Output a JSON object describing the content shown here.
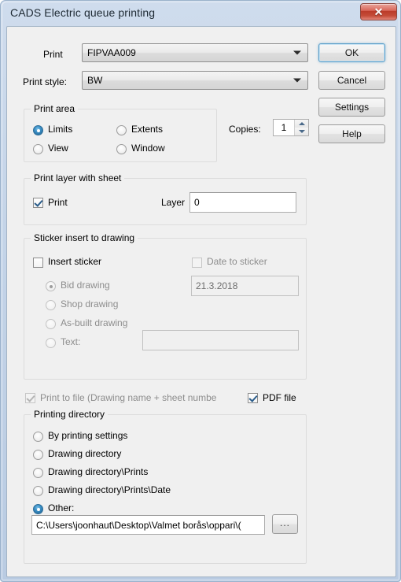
{
  "window": {
    "title": "CADS Electric queue printing",
    "close_glyph": "✕"
  },
  "form": {
    "print_label": "Print",
    "print_value": "FIPVAA009",
    "print_style_label": "Print style:",
    "print_style_value": "BW"
  },
  "buttons": {
    "ok": "OK",
    "cancel": "Cancel",
    "settings": "Settings",
    "help": "Help"
  },
  "print_area": {
    "title": "Print area",
    "options": [
      {
        "label": "Limits",
        "checked": true
      },
      {
        "label": "Extents",
        "checked": false
      },
      {
        "label": "View",
        "checked": false
      },
      {
        "label": "Window",
        "checked": false
      }
    ]
  },
  "copies": {
    "label": "Copies:",
    "value": "1"
  },
  "print_layer": {
    "title": "Print layer with sheet",
    "print_checkbox_label": "Print",
    "print_checked": true,
    "layer_label": "Layer",
    "layer_value": "0"
  },
  "sticker": {
    "title": "Sticker insert to drawing",
    "insert_label": "Insert sticker",
    "insert_checked": false,
    "date_label": "Date to sticker",
    "date_checked": false,
    "date_value": "21.3.2018",
    "options": [
      {
        "label": "Bid drawing",
        "checked": true
      },
      {
        "label": "Shop drawing",
        "checked": false
      },
      {
        "label": "As-built drawing",
        "checked": false
      },
      {
        "label": "Text:",
        "checked": false
      }
    ],
    "text_value": ""
  },
  "print_to_file": {
    "label": "Print to file (Drawing name + sheet numbe",
    "checked": true,
    "pdf_label": "PDF file",
    "pdf_checked": true
  },
  "printing_directory": {
    "title": "Printing directory",
    "options": [
      {
        "label": "By printing settings",
        "checked": false
      },
      {
        "label": "Drawing directory",
        "checked": false
      },
      {
        "label": "Drawing directory\\Prints",
        "checked": false
      },
      {
        "label": "Drawing directory\\Prints\\Date",
        "checked": false
      },
      {
        "label": "Other:",
        "checked": true
      }
    ],
    "path_value": "C:\\Users\\joonhaut\\Desktop\\Valmet borås\\oppari\\(",
    "browse_label": "..."
  }
}
